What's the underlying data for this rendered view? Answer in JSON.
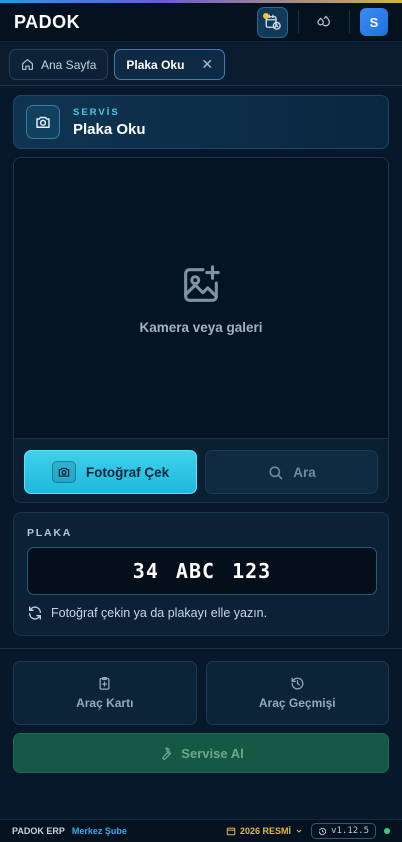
{
  "app": {
    "brand": "PADOK"
  },
  "header": {
    "avatar_initial": "S"
  },
  "tabs": [
    {
      "label": "Ana Sayfa",
      "icon": "home-icon"
    },
    {
      "label": "Plaka Oku",
      "active": true,
      "close": "✕"
    }
  ],
  "service": {
    "label": "SERVİS",
    "title": "Plaka Oku"
  },
  "camera": {
    "placeholder": "Kamera veya galeri",
    "photo_button": "Fotoğraf Çek",
    "search_button": "Ara"
  },
  "plate": {
    "label": "PLAKA",
    "value": "34 ABC 123",
    "hint": "Fotoğraf çekin ya da plakayı elle yazın."
  },
  "actions": {
    "vehicle_card": "Araç Kartı",
    "vehicle_history": "Araç Geçmişi",
    "take_to_service": "Servise Al"
  },
  "status": {
    "app": "PADOK ERP",
    "branch": "Merkez Şube",
    "year": "2026 RESMİ",
    "version": "v1.12.5"
  },
  "colors": {
    "accent": "#3fd1ec",
    "brand_blue": "#3b8df1",
    "service_green": "#145846",
    "year_gold": "#e8b64a",
    "online": "#2dd08a"
  }
}
